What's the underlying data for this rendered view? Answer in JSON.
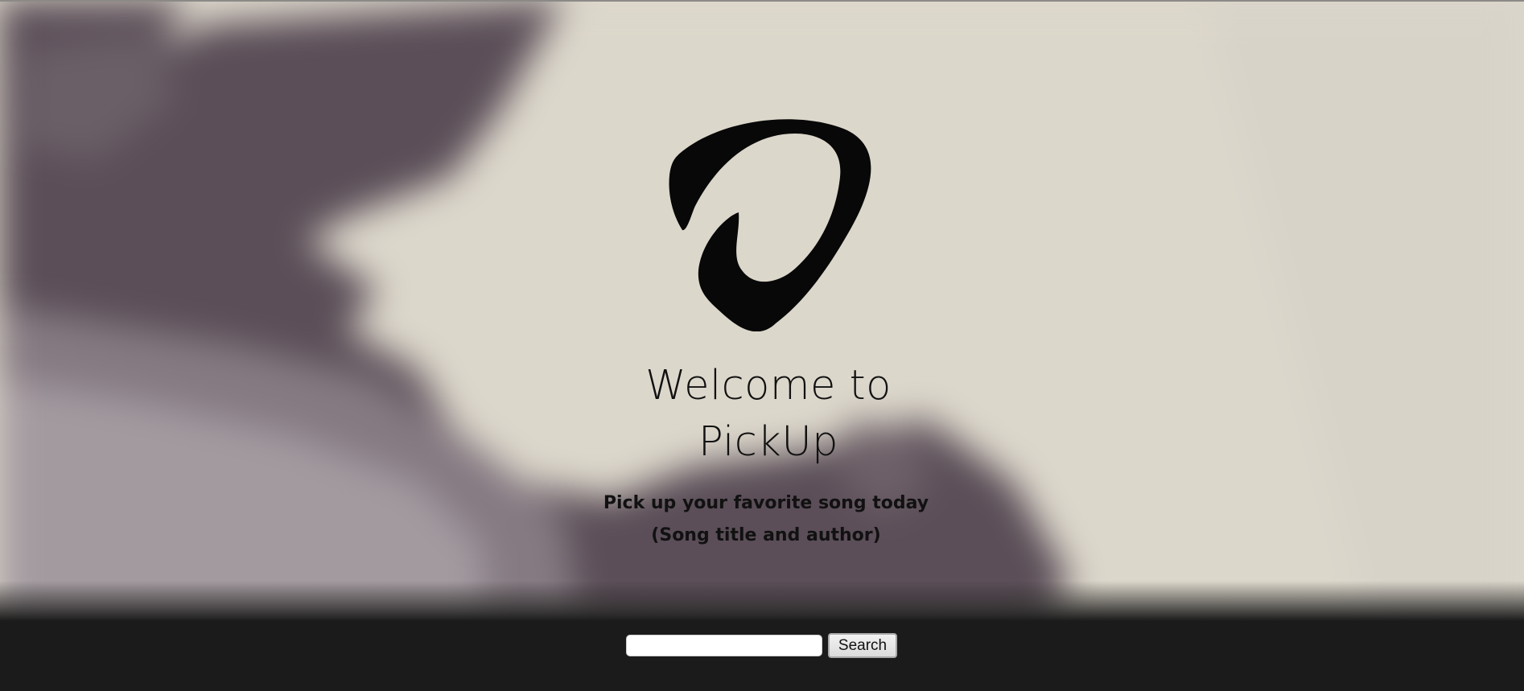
{
  "hero": {
    "logo_icon": "guitar-pick-logo-icon",
    "welcome_line1": "Welcome to",
    "welcome_line2": "PickUp",
    "tagline": "Pick up your favorite song today",
    "hint": "(Song title and author)"
  },
  "search": {
    "placeholder": "",
    "value": "",
    "button_label": "Search"
  },
  "colors": {
    "hero_background": "#dcd7cb",
    "photo_shadow": "#574a55",
    "footer_background": "#1b1b1b",
    "text": "#111111"
  }
}
